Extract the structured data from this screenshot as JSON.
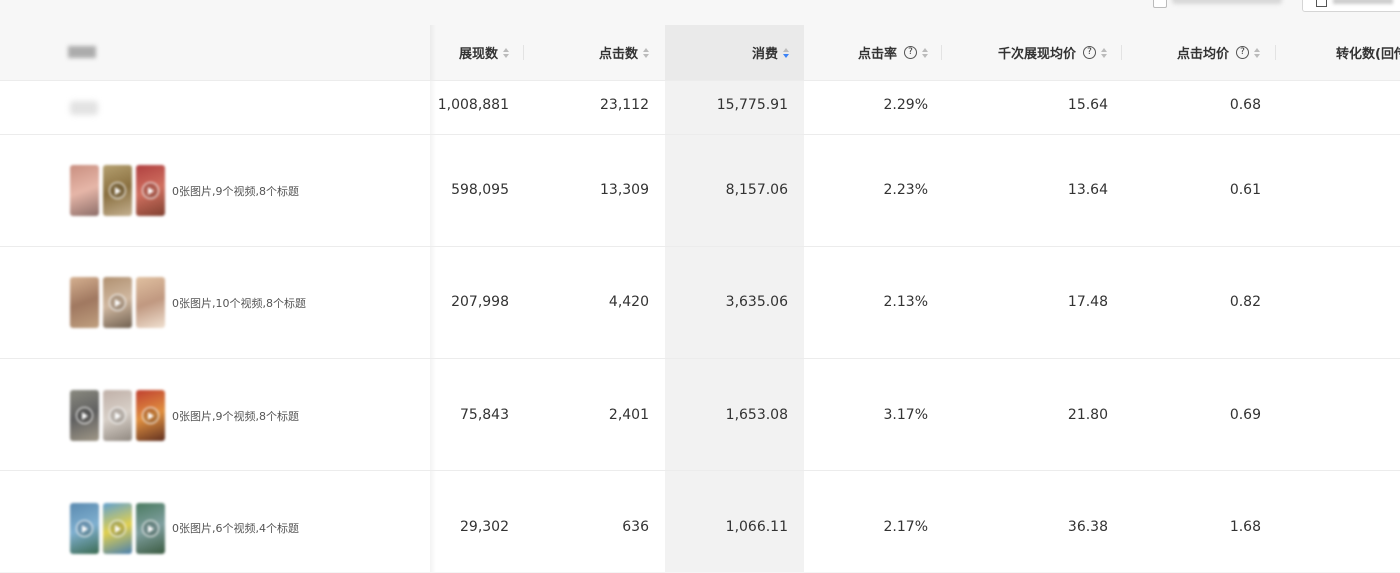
{
  "toolbar": {
    "checkbox_label": "",
    "button_label": ""
  },
  "header": {
    "name_col": "",
    "cols": [
      "展现数",
      "点击数",
      "消费",
      "点击率",
      "千次展现均价",
      "点击均价",
      "转化数(回传"
    ]
  },
  "summary": {
    "values": [
      "1,008,881",
      "23,112",
      "15,775.91",
      "2.29%",
      "15.64",
      "0.68"
    ]
  },
  "rows": [
    {
      "desc": "0张图片,9个视频,8个标题",
      "thumb_colors": [
        [
          "#c98f80",
          "#e6b6a8",
          "#8c6d68"
        ],
        [
          "#b5a070",
          "#8a7040",
          "#c4b090"
        ],
        [
          "#b04040",
          "#d07060",
          "#804030"
        ]
      ],
      "values": [
        "598,095",
        "13,309",
        "8,157.06",
        "2.23%",
        "13.64",
        "0.61"
      ]
    },
    {
      "desc": "0张图片,10个视频,8个标题",
      "thumb_colors": [
        [
          "#d5b090",
          "#a07860",
          "#c0a080"
        ],
        [
          "#b09070",
          "#d0b8a0",
          "#706050"
        ],
        [
          "#e0c0a0",
          "#c09880",
          "#f0e0d0"
        ]
      ],
      "values": [
        "207,998",
        "4,420",
        "3,635.06",
        "2.13%",
        "17.48",
        "0.82"
      ]
    },
    {
      "desc": "0张图片,9个视频,8个标题",
      "thumb_colors": [
        [
          "#8a8a80",
          "#606060",
          "#a09888"
        ],
        [
          "#c0b0a8",
          "#d8d0c8",
          "#908880"
        ],
        [
          "#c04030",
          "#e09040",
          "#603020"
        ]
      ],
      "values": [
        "75,843",
        "2,401",
        "1,653.08",
        "3.17%",
        "21.80",
        "0.69"
      ]
    },
    {
      "desc": "0张图片,6个视频,4个标题",
      "thumb_colors": [
        [
          "#5a8ab0",
          "#80b0d0",
          "#3a6a50"
        ],
        [
          "#60a0d0",
          "#e0d050",
          "#4a80b0"
        ],
        [
          "#4a7a60",
          "#80a0a0",
          "#3a5a40"
        ]
      ],
      "values": [
        "29,302",
        "636",
        "1,066.11",
        "2.17%",
        "36.38",
        "1.68"
      ]
    }
  ]
}
